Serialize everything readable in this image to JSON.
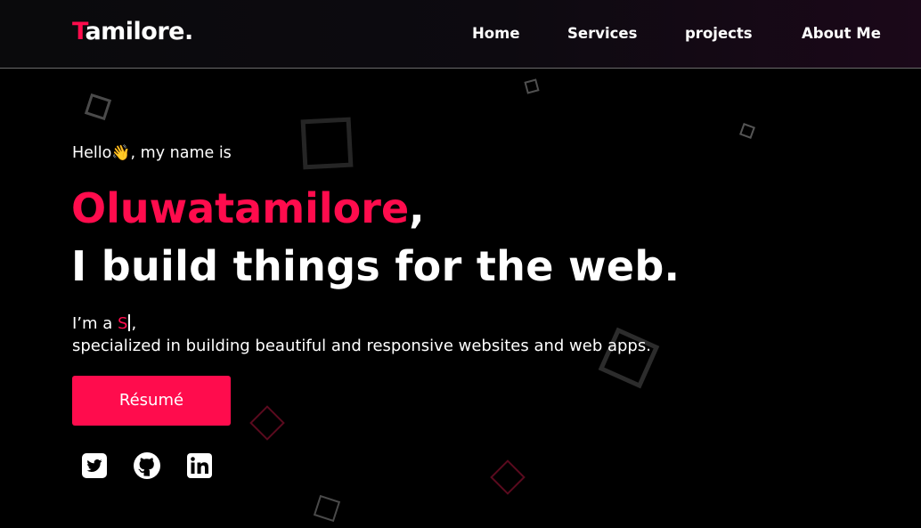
{
  "navbar": {
    "logo_first_letter": "T",
    "logo_rest": "amilore.",
    "links": [
      {
        "label": "Home"
      },
      {
        "label": "Services"
      },
      {
        "label": "projects"
      },
      {
        "label": "About Me"
      }
    ]
  },
  "hero": {
    "greeting_before": "Hello",
    "greeting_emoji": "👋",
    "greeting_after": ", my name is",
    "name": "Oluwatamilore",
    "name_comma": ",",
    "tagline": "I build things for the web.",
    "intro_prefix": "I’m a ",
    "typed_text": "S",
    "intro_suffix": ",",
    "specialized": "specialized in building beautiful and responsive websites and web apps.",
    "resume_label": "Résumé"
  },
  "socials": [
    {
      "icon": "twitter-icon"
    },
    {
      "icon": "github-icon"
    },
    {
      "icon": "linkedin-icon"
    }
  ],
  "colors": {
    "accent": "#ff0c4d",
    "background": "#000000",
    "text": "#ffffff"
  }
}
